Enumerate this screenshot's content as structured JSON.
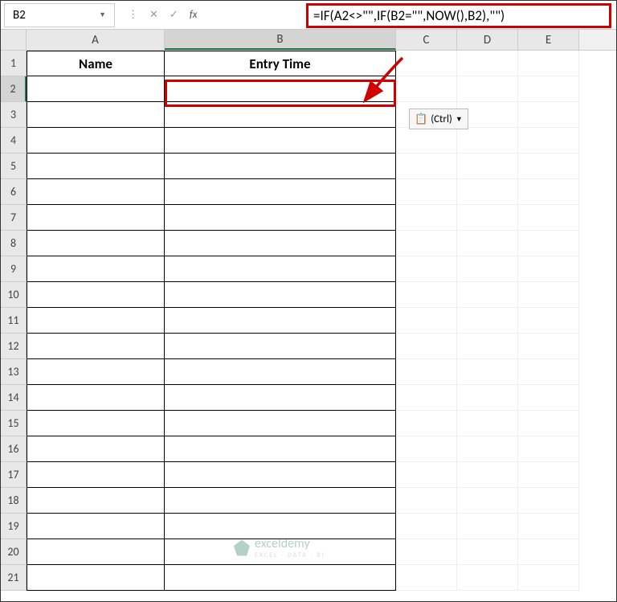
{
  "nameBox": {
    "ref": "B2"
  },
  "formula": {
    "text": "=IF(A2<>\"\",IF(B2=\"\",NOW(),B2),\"\")",
    "fxLabel": "fx"
  },
  "columns": [
    "A",
    "B",
    "C",
    "D",
    "E"
  ],
  "rowNumbers": [
    1,
    2,
    3,
    4,
    5,
    6,
    7,
    8,
    9,
    10,
    11,
    12,
    13,
    14,
    15,
    16,
    17,
    18,
    19,
    20,
    21
  ],
  "headers": {
    "A": "Name",
    "B": "Entry Time"
  },
  "pasteTag": {
    "label": "(Ctrl)"
  },
  "watermark": {
    "brand": "exceldemy",
    "tagline": "EXCEL · DATA · BI"
  },
  "activeRow": 2,
  "activeCol": "B"
}
